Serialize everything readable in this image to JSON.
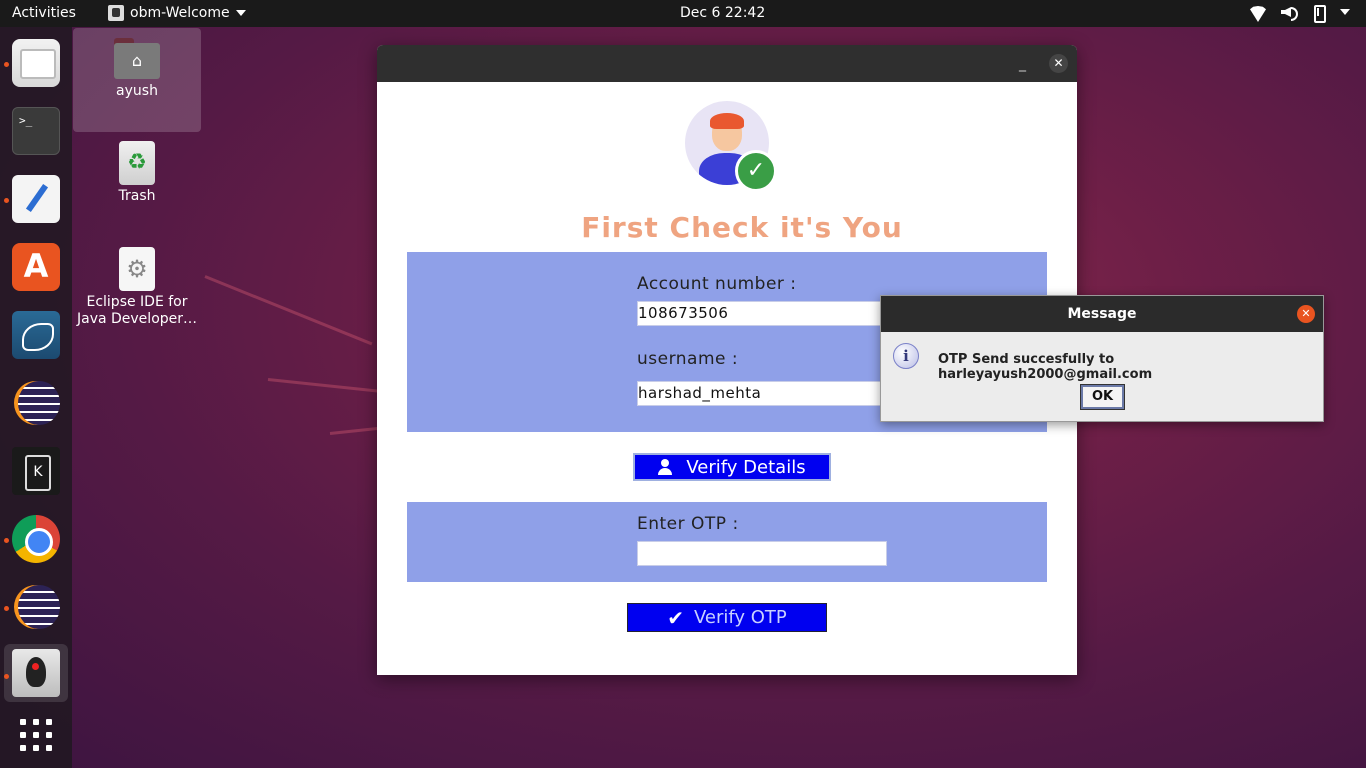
{
  "topbar": {
    "activities": "Activities",
    "app_menu": "obm-Welcome",
    "clock": "Dec 6  22:42",
    "tray_icons": [
      "wifi-icon",
      "speaker-icon",
      "battery-icon"
    ]
  },
  "dock": {
    "items": [
      "files",
      "terminal",
      "text-editor",
      "software-store",
      "mysql-workbench",
      "eclipse",
      "kde-connect",
      "chrome",
      "eclipse-2",
      "java-app",
      "show-applications"
    ],
    "terminal_glyph": ">_",
    "store_glyph": "A"
  },
  "desktop": {
    "icons": [
      {
        "label": "ayush"
      },
      {
        "label": "Trash"
      },
      {
        "label": "Eclipse IDE for Java Developer…"
      }
    ]
  },
  "window": {
    "heading": "First Check it's You",
    "account_label": "Account number :",
    "account_value": "108673506",
    "username_label": "username :",
    "username_value": "harshad_mehta",
    "verify_details_label": "Verify Details",
    "otp_label": "Enter OTP :",
    "otp_value": "",
    "verify_otp_label": "Verify OTP",
    "minimize_glyph": "_",
    "close_glyph": "✕"
  },
  "dialog": {
    "title": "Message",
    "message": "OTP Send succesfully to harleyayush2000@gmail.com",
    "ok_label": "OK",
    "close_glyph": "✕",
    "info_glyph": "i"
  },
  "colors": {
    "accent": "#e95420",
    "panel": "#8fa0e8",
    "button": "#0000f0",
    "heading": "#efa481"
  }
}
